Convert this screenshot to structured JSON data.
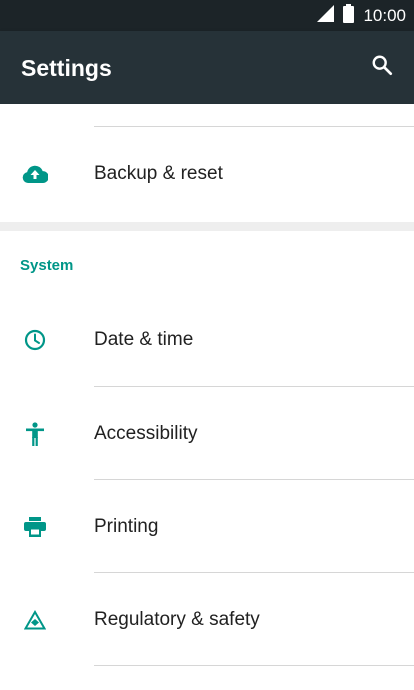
{
  "status": {
    "time": "10:00"
  },
  "toolbar": {
    "title": "Settings"
  },
  "top_section": {
    "items": [
      {
        "label": "Backup & reset",
        "icon": "cloud-upload-icon"
      }
    ]
  },
  "system_section": {
    "header": "System",
    "items": [
      {
        "label": "Date & time",
        "icon": "clock-icon"
      },
      {
        "label": "Accessibility",
        "icon": "accessibility-icon"
      },
      {
        "label": "Printing",
        "icon": "printer-icon"
      },
      {
        "label": "Regulatory & safety",
        "icon": "regulatory-icon"
      }
    ]
  },
  "colors": {
    "accent": "#009688",
    "toolbar": "#263238",
    "status_bar": "#1c2428"
  }
}
